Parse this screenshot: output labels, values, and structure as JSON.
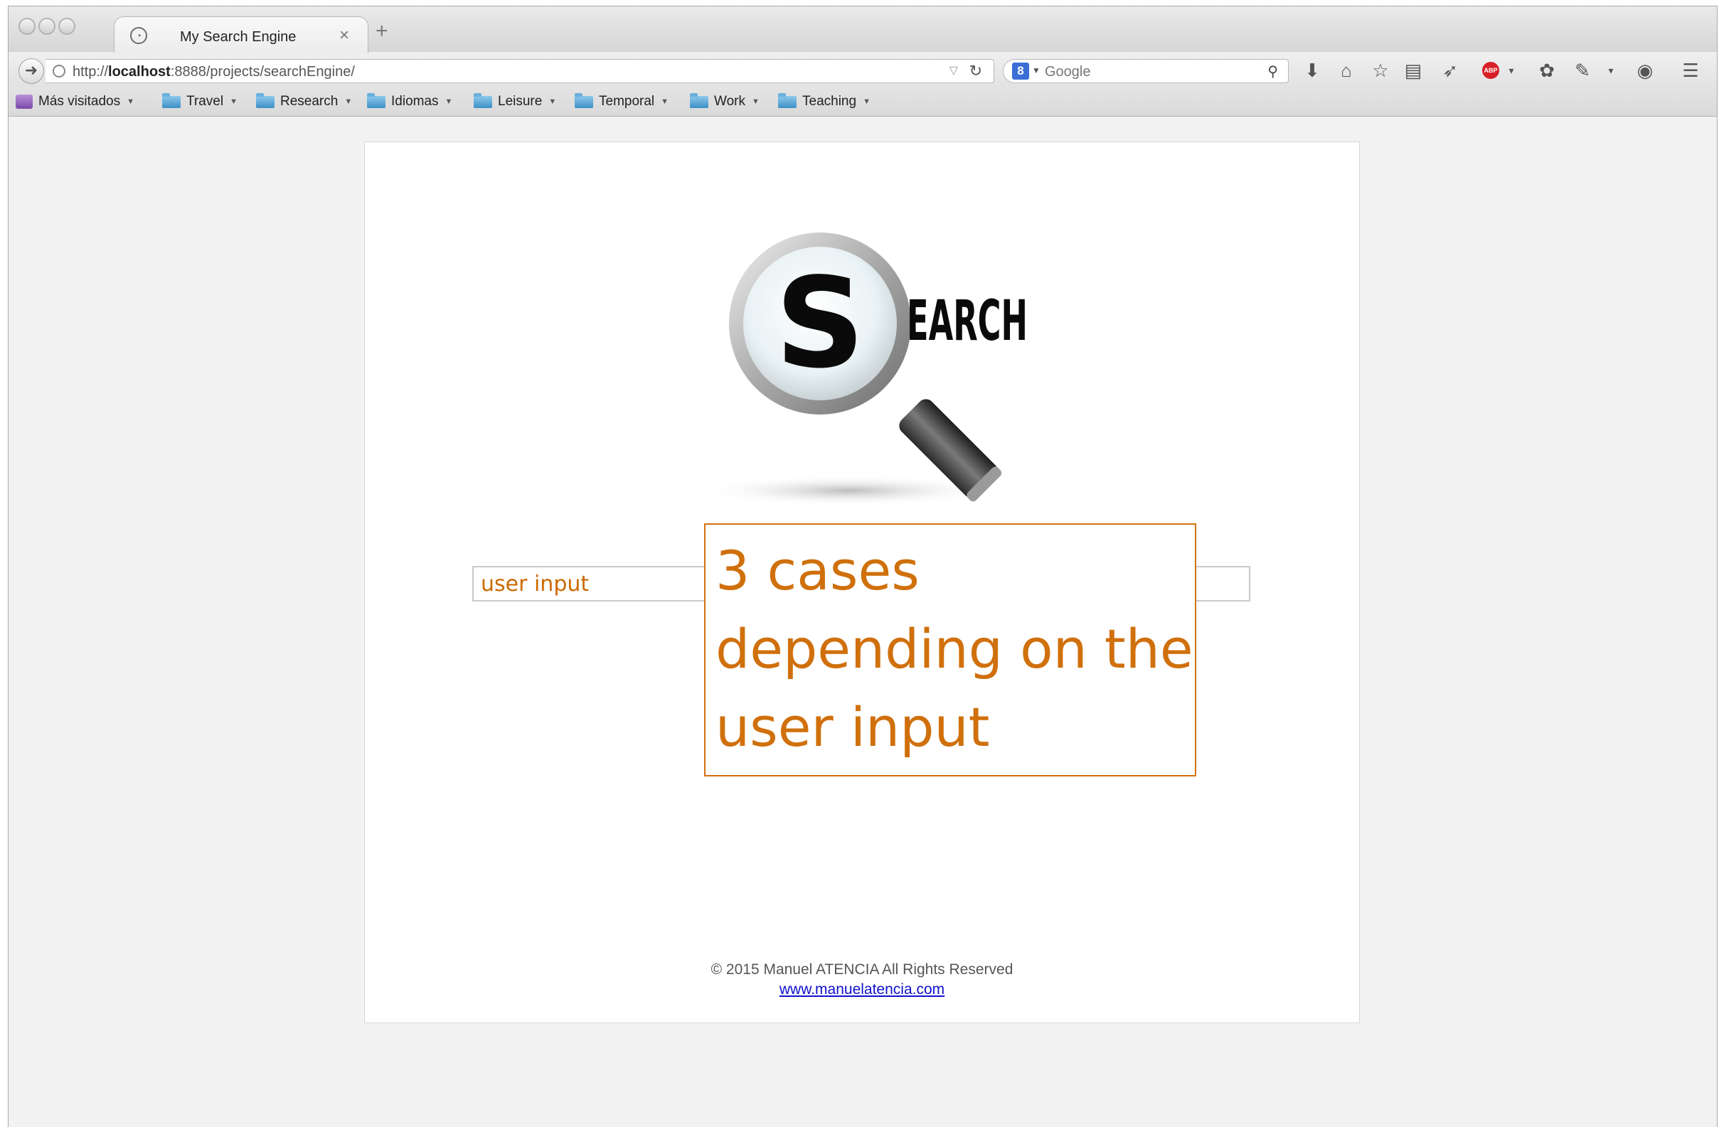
{
  "browser": {
    "tab_title": "My Search Engine",
    "tab_close": "×",
    "new_tab": "+",
    "url_protocol": "http://",
    "url_host": "localhost",
    "url_path": ":8888/projects/searchEngine/",
    "search_engine_placeholder": "Google",
    "search_engine_badge": "8"
  },
  "bookmarks": [
    {
      "label": "Más visitados"
    },
    {
      "label": "Travel"
    },
    {
      "label": "Research"
    },
    {
      "label": "Idiomas"
    },
    {
      "label": "Leisure"
    },
    {
      "label": "Temporal"
    },
    {
      "label": "Work"
    },
    {
      "label": "Teaching"
    }
  ],
  "page": {
    "logo_text": "EARCH",
    "logo_letter": "S",
    "search_value": "user input",
    "callout_text": "3 cases depending on the user input",
    "footer_text": "© 2015 Manuel ATENCIA All Rights Reserved",
    "footer_link": "www.manuelatencia.com"
  },
  "colors": {
    "callout": "#d0700c",
    "link": "#1010cc"
  }
}
